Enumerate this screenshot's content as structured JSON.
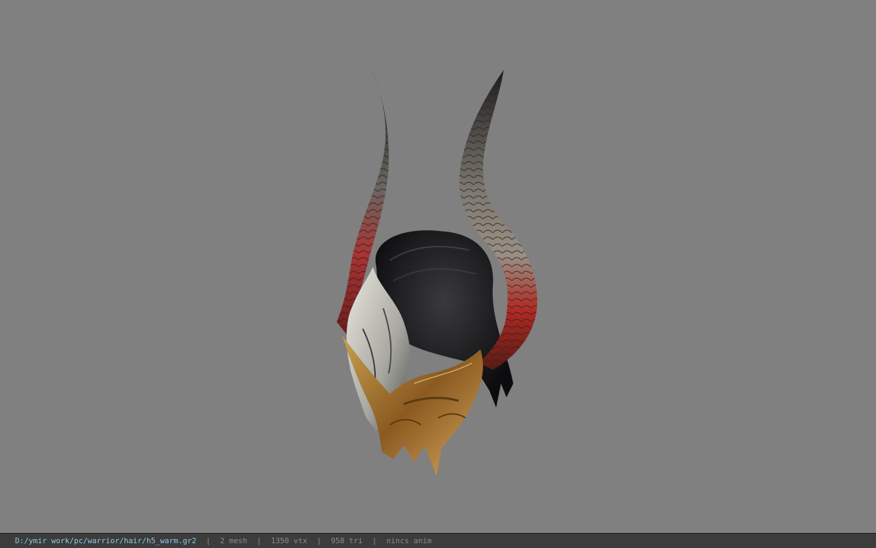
{
  "viewer": {
    "background_color": "#808080",
    "model_icon": "horned-helmet-model"
  },
  "status": {
    "file_path": "D:/ymir work/pc/warrior/hair/h5_warm.gr2",
    "separator": "|",
    "mesh": "2 mesh",
    "vtx": "1350 vtx",
    "tri": "958 tri",
    "anim": "nincs anim"
  }
}
